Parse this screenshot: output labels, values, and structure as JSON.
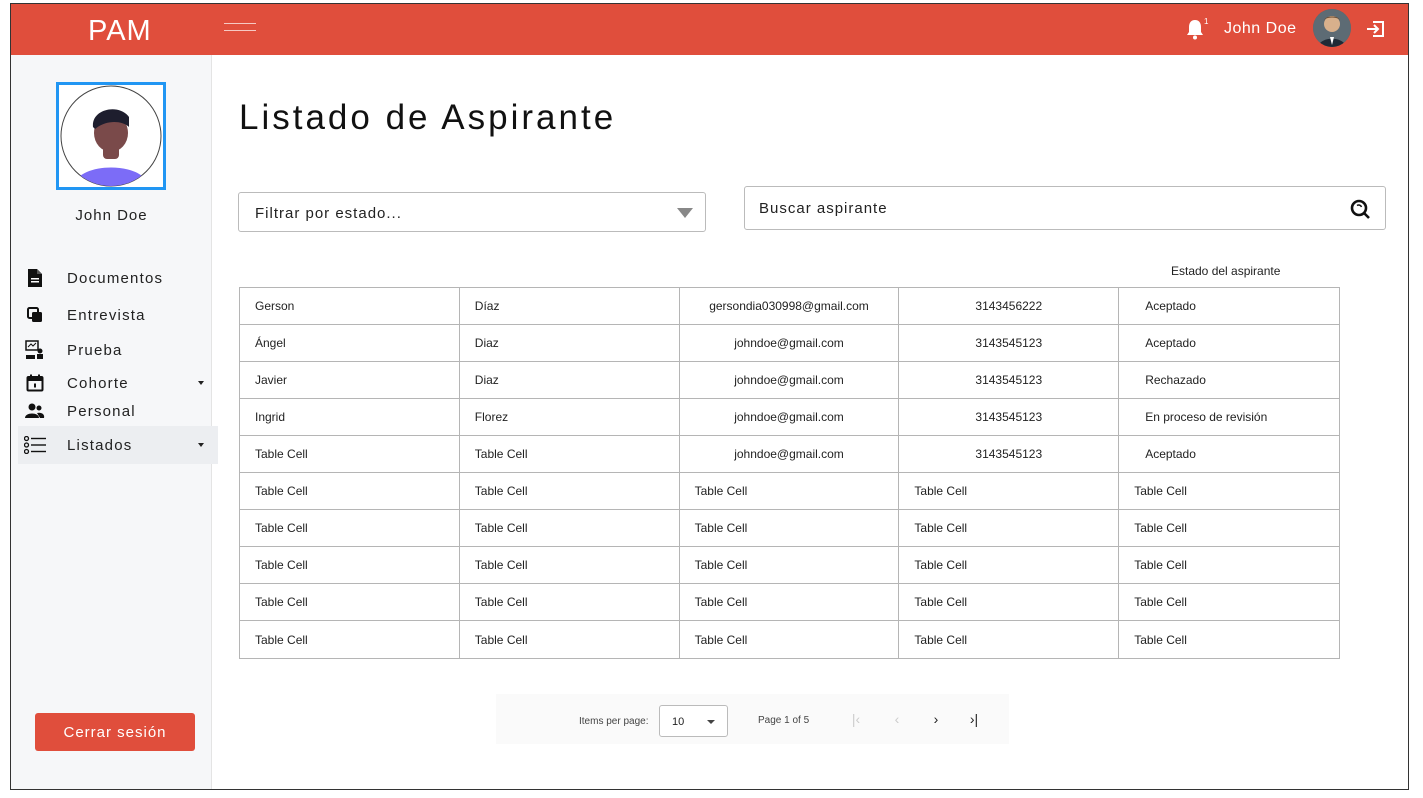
{
  "header": {
    "brand": "PAM",
    "notification_count": "1",
    "user_name": "John Doe"
  },
  "sidebar": {
    "profile_name": "John Doe",
    "items": [
      {
        "label": "Documentos",
        "icon": "document-icon"
      },
      {
        "label": "Entrevista",
        "icon": "copy-icon"
      },
      {
        "label": "Prueba",
        "icon": "presentation-icon"
      },
      {
        "label": "Cohorte",
        "icon": "calendar-icon"
      },
      {
        "label": "Personal",
        "icon": "people-icon"
      },
      {
        "label": "Listados",
        "icon": "list-icon"
      }
    ],
    "logout_label": "Cerrar sesión"
  },
  "main": {
    "title": "Listado de Aspirante",
    "filter_placeholder": "Filtrar por estado...",
    "search_placeholder": "Buscar aspirante",
    "status_column_header": "Estado del aspirante"
  },
  "table": {
    "rows": [
      [
        "Gerson",
        "Díaz",
        "gersondia030998@gmail.com",
        "3143456222",
        "Aceptado"
      ],
      [
        "Ángel",
        "Diaz",
        "johndoe@gmail.com",
        "3143545123",
        "Aceptado"
      ],
      [
        "Javier",
        "Diaz",
        "johndoe@gmail.com",
        "3143545123",
        "Rechazado"
      ],
      [
        "Ingrid",
        "Florez",
        "johndoe@gmail.com",
        "3143545123",
        "En proceso de revisión"
      ],
      [
        "Table Cell",
        "Table Cell",
        "johndoe@gmail.com",
        "3143545123",
        "Aceptado"
      ],
      [
        "Table Cell",
        "Table Cell",
        "Table Cell",
        "Table Cell",
        "Table Cell"
      ],
      [
        "Table Cell",
        "Table Cell",
        "Table Cell",
        "Table Cell",
        "Table Cell"
      ],
      [
        "Table Cell",
        "Table Cell",
        "Table Cell",
        "Table Cell",
        "Table Cell"
      ],
      [
        "Table Cell",
        "Table Cell",
        "Table Cell",
        "Table Cell",
        "Table Cell"
      ],
      [
        "Table Cell",
        "Table Cell",
        "Table Cell",
        "Table Cell",
        "Table Cell"
      ]
    ]
  },
  "pagination": {
    "items_per_page_label": "Items per page:",
    "items_per_page_value": "10",
    "page_info": "Page 1 of 5"
  },
  "colors": {
    "brand": "#e04e3c",
    "avatar_ring": "#2196f3"
  }
}
